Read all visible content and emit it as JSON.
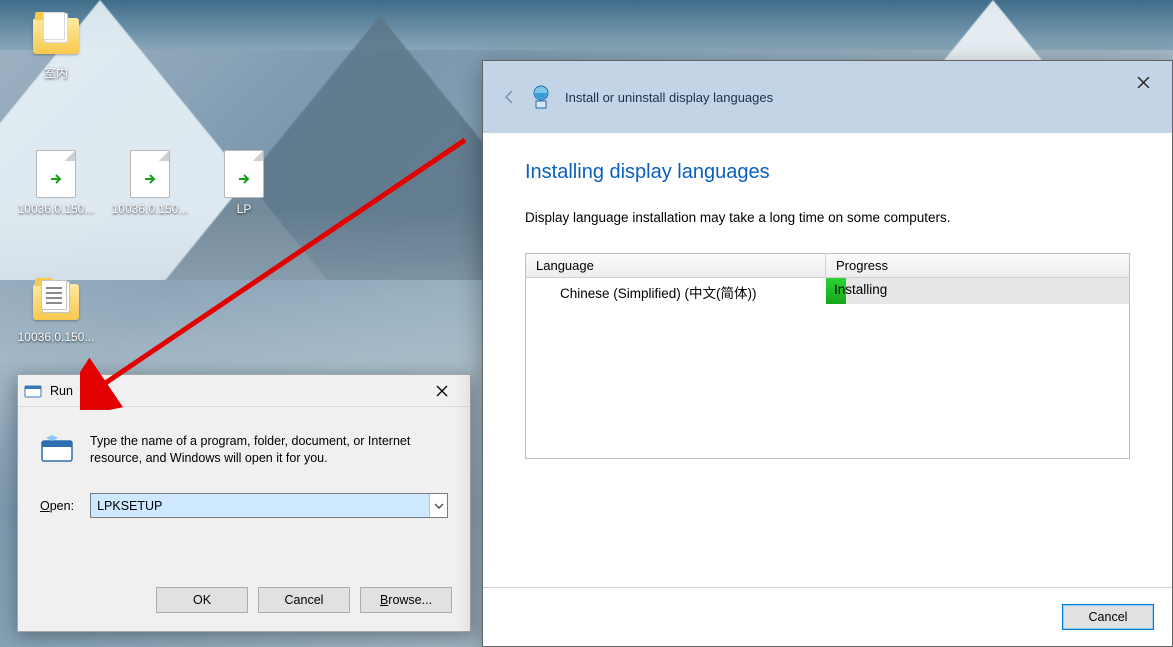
{
  "desktop": {
    "icons": [
      {
        "label": "室内"
      },
      {
        "label": "10036.0.150..."
      },
      {
        "label": "10036.0.150..."
      },
      {
        "label": "LP"
      },
      {
        "label": "10036.0.150..."
      }
    ]
  },
  "run_dialog": {
    "title": "Run",
    "description": "Type the name of a program, folder, document, or Internet resource, and Windows will open it for you.",
    "open_label_prefix": "O",
    "open_label_rest": "pen:",
    "value": "LPKSETUP",
    "ok": "OK",
    "cancel": "Cancel",
    "browse_prefix": "B",
    "browse_rest": "rowse..."
  },
  "wizard": {
    "header_title": "Install or uninstall display languages",
    "heading": "Installing display languages",
    "note": "Display language installation may take a long time on some computers.",
    "columns": {
      "language": "Language",
      "progress": "Progress"
    },
    "row": {
      "language": "Chinese (Simplified) (中文(简体))",
      "status": "Installing"
    },
    "cancel": "Cancel"
  }
}
